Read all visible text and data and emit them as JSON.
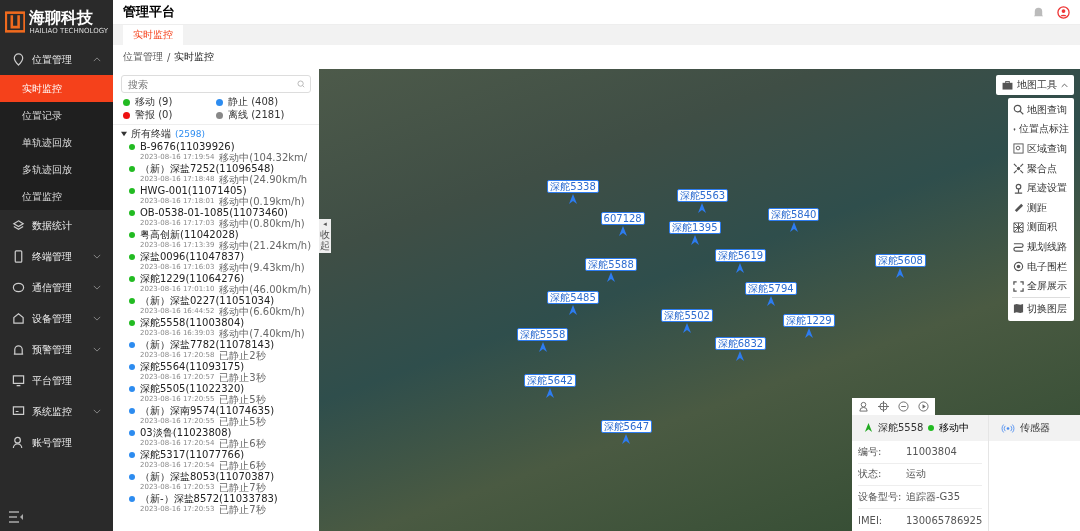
{
  "logo": {
    "name": "海聊科技",
    "subtitle": "HAILIAO TECHNOLOGY"
  },
  "header": {
    "title": "管理平台"
  },
  "sidebar": {
    "items": [
      {
        "label": "位置管理",
        "expanded": true,
        "children": [
          {
            "label": "实时监控",
            "selected": true
          },
          {
            "label": "位置记录",
            "selected": false
          },
          {
            "label": "单轨迹回放",
            "selected": false
          },
          {
            "label": "多轨迹回放",
            "selected": false
          },
          {
            "label": "位置监控",
            "selected": false
          }
        ]
      },
      {
        "label": "数据统计"
      },
      {
        "label": "终端管理",
        "expanded": false
      },
      {
        "label": "通信管理",
        "expanded": false
      },
      {
        "label": "设备管理",
        "expanded": false
      },
      {
        "label": "预警管理",
        "expanded": false
      },
      {
        "label": "平台管理"
      },
      {
        "label": "系统监控",
        "expanded": false
      },
      {
        "label": "账号管理"
      }
    ]
  },
  "tabs": [
    {
      "label": "实时监控",
      "selected": true
    }
  ],
  "breadcrumb": {
    "items": [
      "位置管理",
      "实时监控"
    ],
    "separator": "/"
  },
  "search": {
    "placeholder": "搜索"
  },
  "legend": [
    {
      "label": "移动",
      "count": "(9)",
      "color": "#22bb22"
    },
    {
      "label": "静止",
      "count": "(408)",
      "color": "#2d8cf0"
    },
    {
      "label": "警报",
      "count": "(0)",
      "color": "#ee1111"
    },
    {
      "label": "离线",
      "count": "(2181)",
      "color": "#888888"
    }
  ],
  "tree": {
    "label": "所有终端",
    "count": "(2598)",
    "expanded": true,
    "children": [
      {
        "name": "B-9676(11039926)",
        "time": "2023-08-16 17:19:54",
        "status": "移动中(104.32km/",
        "color": "#22bb22"
      },
      {
        "name": "（新）深盐7252(11096548)",
        "time": "2023-08-16 17:18:48",
        "status": "移动中(24.90km/h",
        "color": "#22bb22"
      },
      {
        "name": "HWG-001(11071405)",
        "time": "2023-08-16 17:18:01",
        "status": "移动中(0.19km/h)",
        "color": "#22bb22"
      },
      {
        "name": "OB-0538-01-1085(11073460)",
        "time": "2023-08-16 17:17:03",
        "status": "移动中(0.80km/h)",
        "color": "#22bb22"
      },
      {
        "name": "粤高创新(11042028)",
        "time": "2023-08-16 17:13:39",
        "status": "移动中(21.24km/h)",
        "color": "#22bb22"
      },
      {
        "name": "深盐0096(11047837)",
        "time": "2023-08-16 17:16:03",
        "status": "移动中(9.43km/h)",
        "color": "#22bb22"
      },
      {
        "name": "深舵1229(11064276)",
        "time": "2023-08-16 17:01:10",
        "status": "移动中(46.00km/h)",
        "color": "#22bb22"
      },
      {
        "name": "（新）深盐0227(11051034)",
        "time": "2023-08-16 16:44:52",
        "status": "移动中(6.60km/h)",
        "color": "#22bb22"
      },
      {
        "name": "深舵5558(11003804)",
        "time": "2023-08-16 16:39:03",
        "status": "移动中(7.40km/h)",
        "color": "#22bb22"
      },
      {
        "name": "（新）深盐7782(11078143)",
        "time": "2023-08-16 17:20:58",
        "status": "已静止2秒",
        "color": "#2d8cf0"
      },
      {
        "name": "深舵5564(11093175)",
        "time": "2023-08-16 17:20:57",
        "status": "已静止3秒",
        "color": "#2d8cf0"
      },
      {
        "name": "深舵5505(11022320)",
        "time": "2023-08-16 17:20:55",
        "status": "已静止5秒",
        "color": "#2d8cf0"
      },
      {
        "name": "（新）深南9574(11074635)",
        "time": "2023-08-16 17:20:55",
        "status": "已静止5秒",
        "color": "#2d8cf0"
      },
      {
        "name": "03淡鲁(11023808)",
        "time": "2023-08-16 17:20:54",
        "status": "已静止6秒",
        "color": "#2d8cf0"
      },
      {
        "name": "深舵5317(11077766)",
        "time": "2023-08-16 17:20:54",
        "status": "已静止6秒",
        "color": "#2d8cf0"
      },
      {
        "name": "（新）深盐8053(11070387)",
        "time": "2023-08-16 17:20:53",
        "status": "已静止7秒",
        "color": "#2d8cf0"
      },
      {
        "name": "（新-）深盐8572(11033783)",
        "time": "2023-08-16 17:20:53",
        "status": "已静止7秒",
        "color": "#2d8cf0"
      }
    ]
  },
  "collapse_tab": {
    "arrow": "◂",
    "label": "收起"
  },
  "map_markers": [
    "深舵5338",
    "深舵5563",
    "深舵1395",
    "深舵5840",
    "深舵5608",
    "607128",
    "深舵5588",
    "深舵5485",
    "深舵5558",
    "深舵5642",
    "深舵5647",
    "深舵5619",
    "深舵5794",
    "深舵5502",
    "深舵6832",
    "深舵1229"
  ],
  "map_tools": {
    "label": "地图工具",
    "expanded": true,
    "items": [
      {
        "label": "地图查询"
      },
      {
        "label": "位置点标注"
      },
      {
        "label": "区域查询"
      },
      {
        "label": "聚合点"
      },
      {
        "label": "尾迹设置"
      },
      {
        "label": "测距"
      },
      {
        "label": "测面积"
      },
      {
        "label": "规划线路"
      },
      {
        "label": "电子围栏"
      },
      {
        "label": "全屏展示"
      },
      {
        "label": "切换图层",
        "divider": true
      }
    ]
  },
  "detail": {
    "name": "深舵5558",
    "status": "移动中",
    "sensor_tab": "传感器",
    "fields": [
      {
        "label": "编号:",
        "value": "11003804"
      },
      {
        "label": "状态:",
        "value": "运动"
      },
      {
        "label": "设备型号:",
        "value": "追踪器-G35"
      },
      {
        "label": "IMEI:",
        "value": "130065786925"
      }
    ]
  }
}
